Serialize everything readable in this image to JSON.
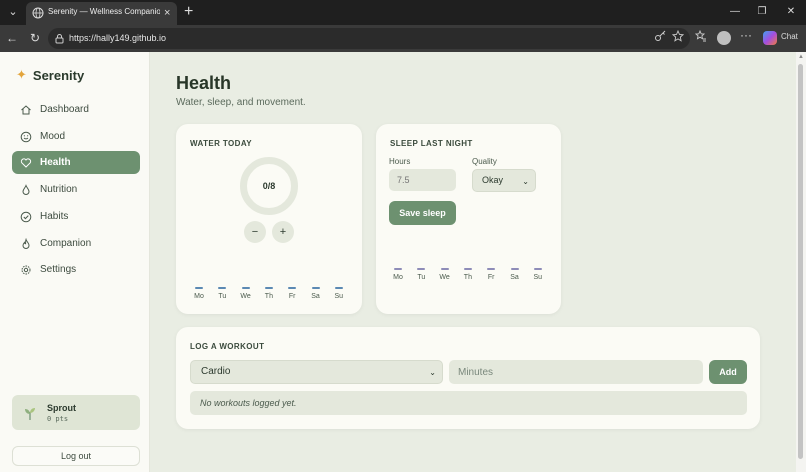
{
  "browser": {
    "tab_title": "Serenity — Wellness Companion",
    "url_host": "https://hally149.github.io",
    "chat_label": "Chat",
    "icons": [
      "tab-menu-icon",
      "globe-icon",
      "close-icon",
      "new-tab-icon",
      "minimize-icon",
      "restore-icon",
      "back-icon",
      "refresh-icon",
      "lock-icon",
      "key-icon",
      "star-icon",
      "favorites-icon",
      "profile-icon",
      "more-icon",
      "copilot-icon"
    ]
  },
  "sidebar": {
    "brand_icon": "✦",
    "brand": "Serenity",
    "items": [
      {
        "label": "Dashboard",
        "icon": "home-icon",
        "active": false
      },
      {
        "label": "Mood",
        "icon": "smile-icon",
        "active": false
      },
      {
        "label": "Health",
        "icon": "heart-icon",
        "active": true
      },
      {
        "label": "Nutrition",
        "icon": "drop-icon",
        "active": false
      },
      {
        "label": "Habits",
        "icon": "check-circle-icon",
        "active": false
      },
      {
        "label": "Companion",
        "icon": "flame-icon",
        "active": false
      },
      {
        "label": "Settings",
        "icon": "gear-icon",
        "active": false
      }
    ],
    "profile": {
      "name": "Sprout",
      "points": "0 pts"
    },
    "logout": "Log out"
  },
  "header": {
    "title": "Health",
    "subtitle": "Water, sleep, and movement."
  },
  "water": {
    "title": "WATER TODAY",
    "glasses": 0,
    "goal": 8,
    "display": "0/8",
    "minus": "−",
    "plus": "+",
    "days": [
      "Mo",
      "Tu",
      "We",
      "Th",
      "Fr",
      "Sa",
      "Su"
    ],
    "bar_color": "#5b89b3"
  },
  "sleep": {
    "title": "SLEEP LAST NIGHT",
    "hours_label": "Hours",
    "hours_placeholder": "7.5",
    "quality_label": "Quality",
    "quality_value": "Okay",
    "save_label": "Save sleep",
    "days": [
      "Mo",
      "Tu",
      "We",
      "Th",
      "Fr",
      "Sa",
      "Su"
    ],
    "bar_color": "#8e8cb8"
  },
  "workout": {
    "title": "LOG A WORKOUT",
    "type_value": "Cardio",
    "minutes_placeholder": "Minutes",
    "add_label": "Add",
    "empty_text": "No workouts logged yet."
  },
  "colors": {
    "accent": "#6d9170",
    "background": "#e9ede3",
    "card": "#fbfbf5",
    "brand_star": "#e3a53c"
  }
}
